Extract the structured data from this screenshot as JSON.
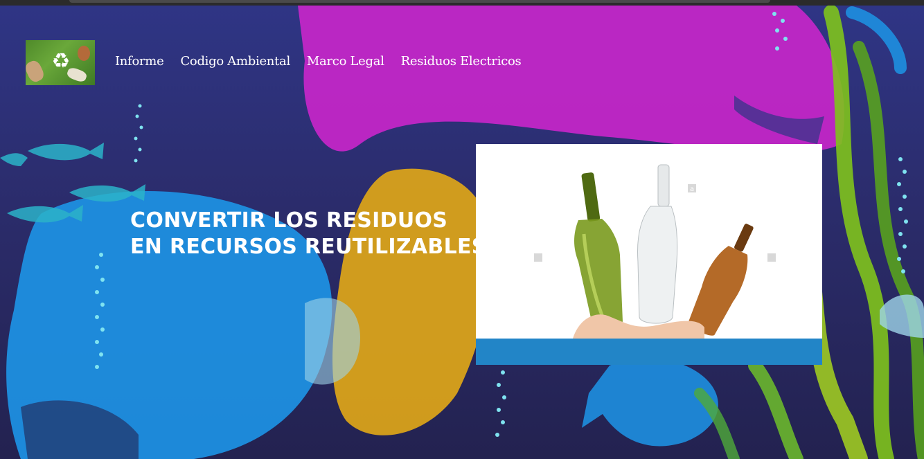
{
  "nav": {
    "items": [
      "Informe",
      "Codigo Ambiental",
      "Marco Legal",
      "Residuos Electricos"
    ]
  },
  "logo": {
    "icon": "recycle-icon",
    "glyph": "♻"
  },
  "hero": {
    "title_line1": "CONVERTIR LOS RESIDUOS",
    "title_line2": "EN RECURSOS REUTILIZABLES"
  },
  "card": {
    "watermark": "a",
    "bar_color": "#2285c7"
  },
  "colors": {
    "background_top": "#2f3585",
    "background_bottom": "#232250",
    "magenta_bag": "#c726c9",
    "blue_bag": "#1e8fe0",
    "yellow_bag": "#d9a21a",
    "seaweed": "#7fc31c"
  }
}
